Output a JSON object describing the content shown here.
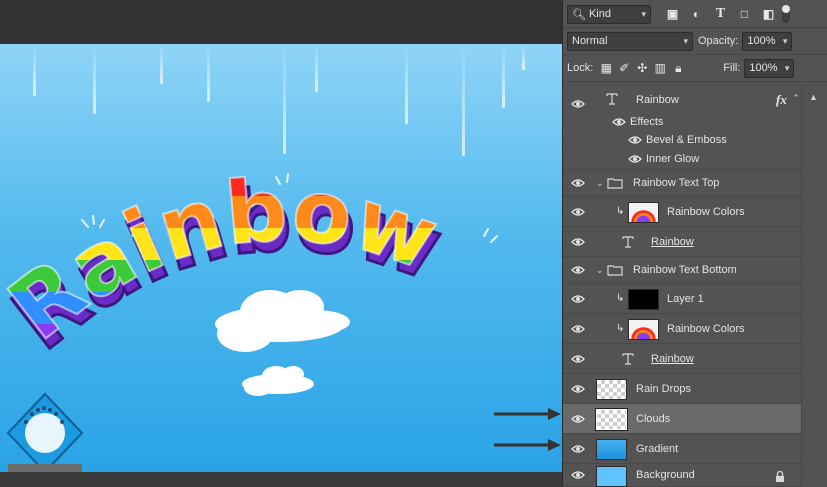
{
  "toolbar": {
    "filter_select": "Kind",
    "filter_icons": [
      "image-filter-icon",
      "adjustment-filter-icon",
      "type-filter-icon",
      "shape-filter-icon",
      "smart-object-filter-icon"
    ],
    "blend_mode": "Normal",
    "opacity_label": "Opacity:",
    "opacity_value": "100%",
    "lock_label": "Lock:",
    "fill_label": "Fill:",
    "fill_value": "100%"
  },
  "layers": {
    "rainbow_type": {
      "name": "Rainbow",
      "fx": "fx"
    },
    "effects": {
      "label": "Effects",
      "items": [
        "Bevel & Emboss",
        "Inner Glow"
      ]
    },
    "group_top": {
      "name": "Rainbow Text Top"
    },
    "colors_top": {
      "name": "Rainbow Colors"
    },
    "rainbow_top_text": {
      "name": "Rainbow"
    },
    "group_bottom": {
      "name": "Rainbow Text Bottom"
    },
    "layer1": {
      "name": "Layer 1"
    },
    "colors_bottom": {
      "name": "Rainbow Colors"
    },
    "rainbow_bottom_text": {
      "name": "Rainbow"
    },
    "rain_drops": {
      "name": "Rain Drops"
    },
    "clouds": {
      "name": "Clouds"
    },
    "gradient": {
      "name": "Gradient"
    },
    "background": {
      "name": "Background"
    }
  },
  "canvas": {
    "headline": "Rainbow",
    "rainbow_colors": [
      "#ff2a1f",
      "#ff8a1c",
      "#ffe41a",
      "#3cc93a",
      "#2f8fff",
      "#8a3df0"
    ]
  },
  "colors": {
    "panel": "#535353",
    "selected_row": "#6a6a6a",
    "sky_top": "#8fd4f7",
    "sky_bottom": "#2aa3e6"
  }
}
